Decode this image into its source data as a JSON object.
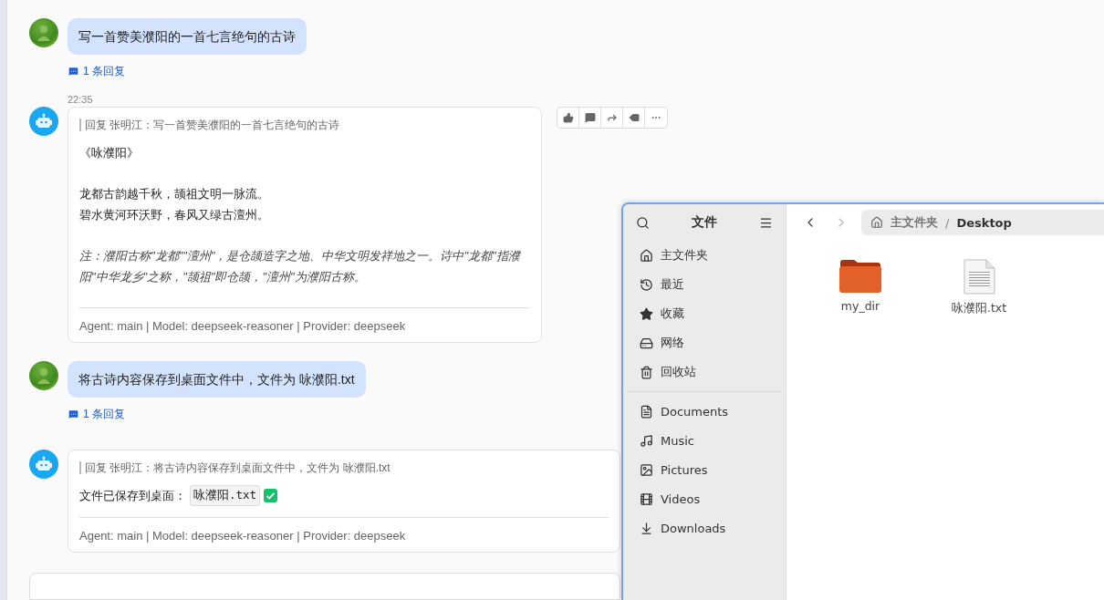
{
  "messages": [
    {
      "kind": "user",
      "text": "写一首赞美濮阳的一首七言绝句的古诗",
      "reply_count": "1 条回复"
    },
    {
      "kind": "bot",
      "time": "22:35",
      "quote": "回复 张明江：写一首赞美濮阳的一首七言绝句的古诗",
      "blocks": [
        {
          "kind": "para",
          "lines": [
            "《咏濮阳》"
          ]
        },
        {
          "kind": "para",
          "lines": [
            "龙都古韵越千秋，颉祖文明一脉流。",
            "碧水黄河环沃野，春风又绿古澶州。"
          ]
        },
        {
          "kind": "note",
          "lines": [
            "注：濮阳古称\"龙都\"\"澶州\"，是仓颉造字之地、中华文明发祥地之一。诗中\"龙都\"指濮阳\"中华龙乡\"之称，\"颉祖\"即仓颉，\"澶州\"为濮阳古称。"
          ]
        }
      ],
      "footer": "Agent: main | Model: deepseek-reasoner | Provider: deepseek",
      "actions": true
    },
    {
      "kind": "user",
      "text": "将古诗内容保存到桌面文件中，文件为 咏濮阳.txt",
      "reply_count": "1 条回复"
    },
    {
      "kind": "bot",
      "quote": "回复 张明江：将古诗内容保存到桌面文件中，文件为 咏濮阳.txt",
      "blocks": [
        {
          "kind": "saved",
          "text": "文件已保存到桌面：",
          "code": "咏濮阳.txt"
        }
      ],
      "footer": "Agent: main | Model: deepseek-reasoner | Provider: deepseek",
      "actions": false
    }
  ],
  "file_manager": {
    "title": "文件",
    "places": [
      {
        "kind": "home",
        "label": "主文件夹"
      },
      {
        "kind": "recent",
        "label": "最近"
      },
      {
        "kind": "starred",
        "label": "收藏"
      },
      {
        "kind": "network",
        "label": "网络"
      },
      {
        "kind": "trash",
        "label": "回收站"
      }
    ],
    "bookmarks": [
      {
        "kind": "documents",
        "label": "Documents"
      },
      {
        "kind": "music",
        "label": "Music"
      },
      {
        "kind": "pictures",
        "label": "Pictures"
      },
      {
        "kind": "videos",
        "label": "Videos"
      },
      {
        "kind": "downloads",
        "label": "Downloads"
      }
    ],
    "path": [
      "主文件夹",
      "Desktop"
    ],
    "path_separator": "/",
    "items": [
      {
        "kind": "folder",
        "name": "my_dir"
      },
      {
        "kind": "text-file",
        "name": "咏濮阳.txt"
      }
    ]
  }
}
